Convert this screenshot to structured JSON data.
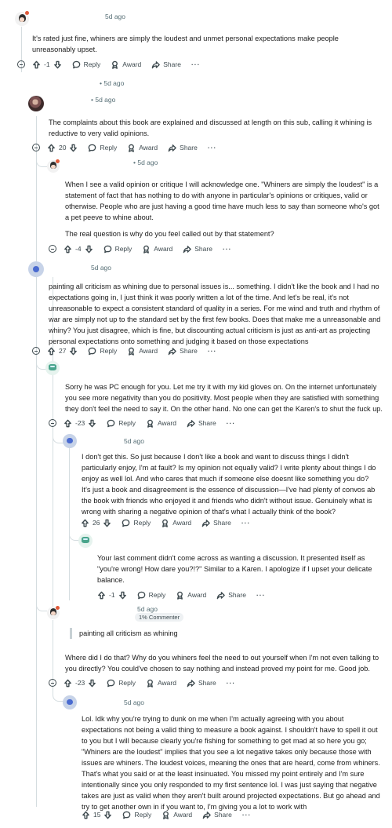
{
  "ui": {
    "reply_label": "Reply",
    "award_label": "Award",
    "share_label": "Share",
    "more_label": "···",
    "upvote_icon": "upvote-arrow-icon",
    "downvote_icon": "downvote-arrow-icon",
    "reply_icon": "speech-bubble-icon",
    "award_icon": "award-ribbon-icon",
    "share_icon": "share-arrow-icon",
    "collapse_icon": "collapse-minus-icon"
  },
  "comments": [
    {
      "time": "5d ago",
      "votes": "-1",
      "paras": [
        "It's rated just fine, whiners are simply the loudest and unmet personal expectations make people unreasonably upset."
      ]
    },
    {
      "time": "• 5d ago"
    },
    {
      "time": "• 5d ago",
      "votes": "20",
      "paras": [
        "The complaints about this book are explained and discussed at length on this sub, calling it whining is reductive to very valid opinions."
      ]
    },
    {
      "time": "• 5d ago",
      "votes": "-4",
      "paras": [
        "When I see a valid opinion or critique I will acknowledge one. \"Whiners are simply the loudest\" is a statement of fact that has nothing to do with anyone in particular's opinions or critiques, valid or otherwise. People who are just having a good time have much less to say than someone who's got a pet peeve to whine about.",
        "The real question is why do you feel called out by that statement?"
      ]
    },
    {
      "time": "5d ago",
      "votes": "27",
      "paras": [
        "painting all criticism as whining due to personal issues is... something. I didn't like the book and I had no expectations going in, I just think it was poorly written a lot of the time. And let's be real, it's not unreasonable to expect a consistent standard of quality in a series. For me wind and truth and rhythm of war are simply not up to the standard set by the first few books. Does that make me a unreasonable and whiny? You just disagree, which is fine, but discounting actual criticism is just as anti-art as projecting personal expectations onto something and judging it based on those expectations"
      ]
    },
    {
      "time": "",
      "votes": "-23",
      "paras": [
        "Sorry he was PC enough for you. Let me try it with my kid gloves on. On the internet unfortunately you see more negativity than you do positivity. Most people when they are satisfied with something they don't feel the need to say it. On the other hand. No one can get the Karen's to shut the fuck up."
      ]
    },
    {
      "time": "5d ago",
      "votes": "26",
      "paras": [
        "I don't get this. So just because I don't like a book and want to discuss things I didn't particularly enjoy, I'm at fault? Is my opinion not equally valid? I write plenty about things I do enjoy as well lol. And who cares that much if someone else doesnt like something you do? It's just a book and disagreement is the essence of discussion—I've had plenty of convos ab the book with friends who enjoyed it and friends who didn't without issue. Genuinely what is wrong with sharing a negative opinion of that's what I actually think of the book?"
      ]
    },
    {
      "time": "",
      "votes": "-1",
      "paras": [
        "Your last comment didn't come across as wanting a discussion. It presented itself as \"you're wrong! How dare you?!?\" Similar to a Karen. I apologize if I upset your delicate balance."
      ]
    },
    {
      "time": "5d ago",
      "flair": "1% Commenter",
      "votes": "-23",
      "quote": "painting all criticism as whining",
      "paras": [
        "Where did I do that? Why do you whiners feel the need to out yourself when I'm not even talking to you directly? You could've chosen to say nothing and instead proved my point for me. Good job."
      ]
    },
    {
      "time": "5d ago",
      "votes": "15",
      "paras": [
        "Lol. Idk why you're trying to dunk on me when I'm actually agreeing with you about expectations not being a valid thing to measure a book against. I shouldn't have to spell it out to you but I will because clearly you're fishing for something to get mad at so here you go; \"Whiners are the loudest\" implies that you see a lot negative takes only because those with issues are whiners. The loudest voices, meaning the ones that are heard, come from whiners. That's what you said or at the least insinuated. You missed my point entirely and I'm sure intentionally since you only responded to my first sentence lol. I was just saying that negative takes are just as valid when they aren't built around projected expectations. But go ahead and try to get another own in if you want to, I'm giving you a lot to work with"
      ]
    }
  ]
}
